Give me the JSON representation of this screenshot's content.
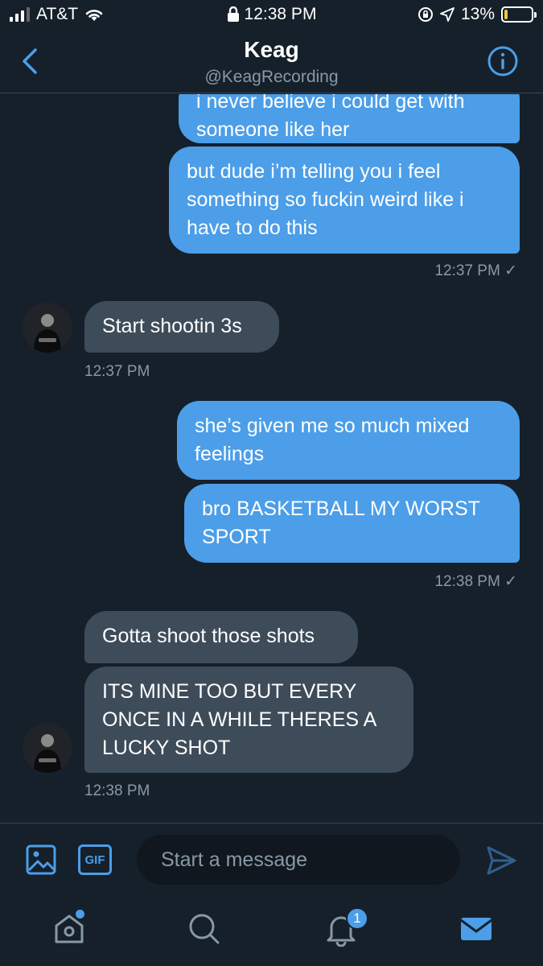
{
  "status_bar": {
    "carrier": "AT&T",
    "time": "12:38 PM",
    "battery": "13%",
    "battery_level": 0.13
  },
  "header": {
    "title": "Keag",
    "handle": "@KeagRecording",
    "icons": {
      "back": "chevron-left-icon",
      "info": "info-icon"
    }
  },
  "messages": [
    {
      "direction": "out",
      "text": "i never believe i could get with someone like her"
    },
    {
      "direction": "out",
      "text": "but dude i’m telling you i feel something so fuckin weird like i have to do this"
    },
    {
      "type": "timestamp",
      "text": "12:37 PM ✓"
    },
    {
      "direction": "in",
      "text": "Start shootin 3s"
    },
    {
      "type": "timestamp",
      "text": "12:37 PM"
    },
    {
      "direction": "out",
      "text": "she’s given me so much mixed feelings"
    },
    {
      "direction": "out",
      "text": "bro BASKETBALL MY WORST SPORT"
    },
    {
      "type": "timestamp",
      "text": "12:38 PM ✓"
    },
    {
      "direction": "in",
      "text": "Gotta shoot those shots"
    },
    {
      "direction": "in",
      "text": "ITS MINE TOO BUT EVERY ONCE IN A WHILE THERES A LUCKY SHOT"
    },
    {
      "type": "timestamp",
      "text": "12:38 PM"
    }
  ],
  "composer": {
    "placeholder": "Start a message",
    "gif_label": "GIF"
  },
  "tabbar": {
    "notifications_badge": "1",
    "accent": "#4c9ee8"
  }
}
